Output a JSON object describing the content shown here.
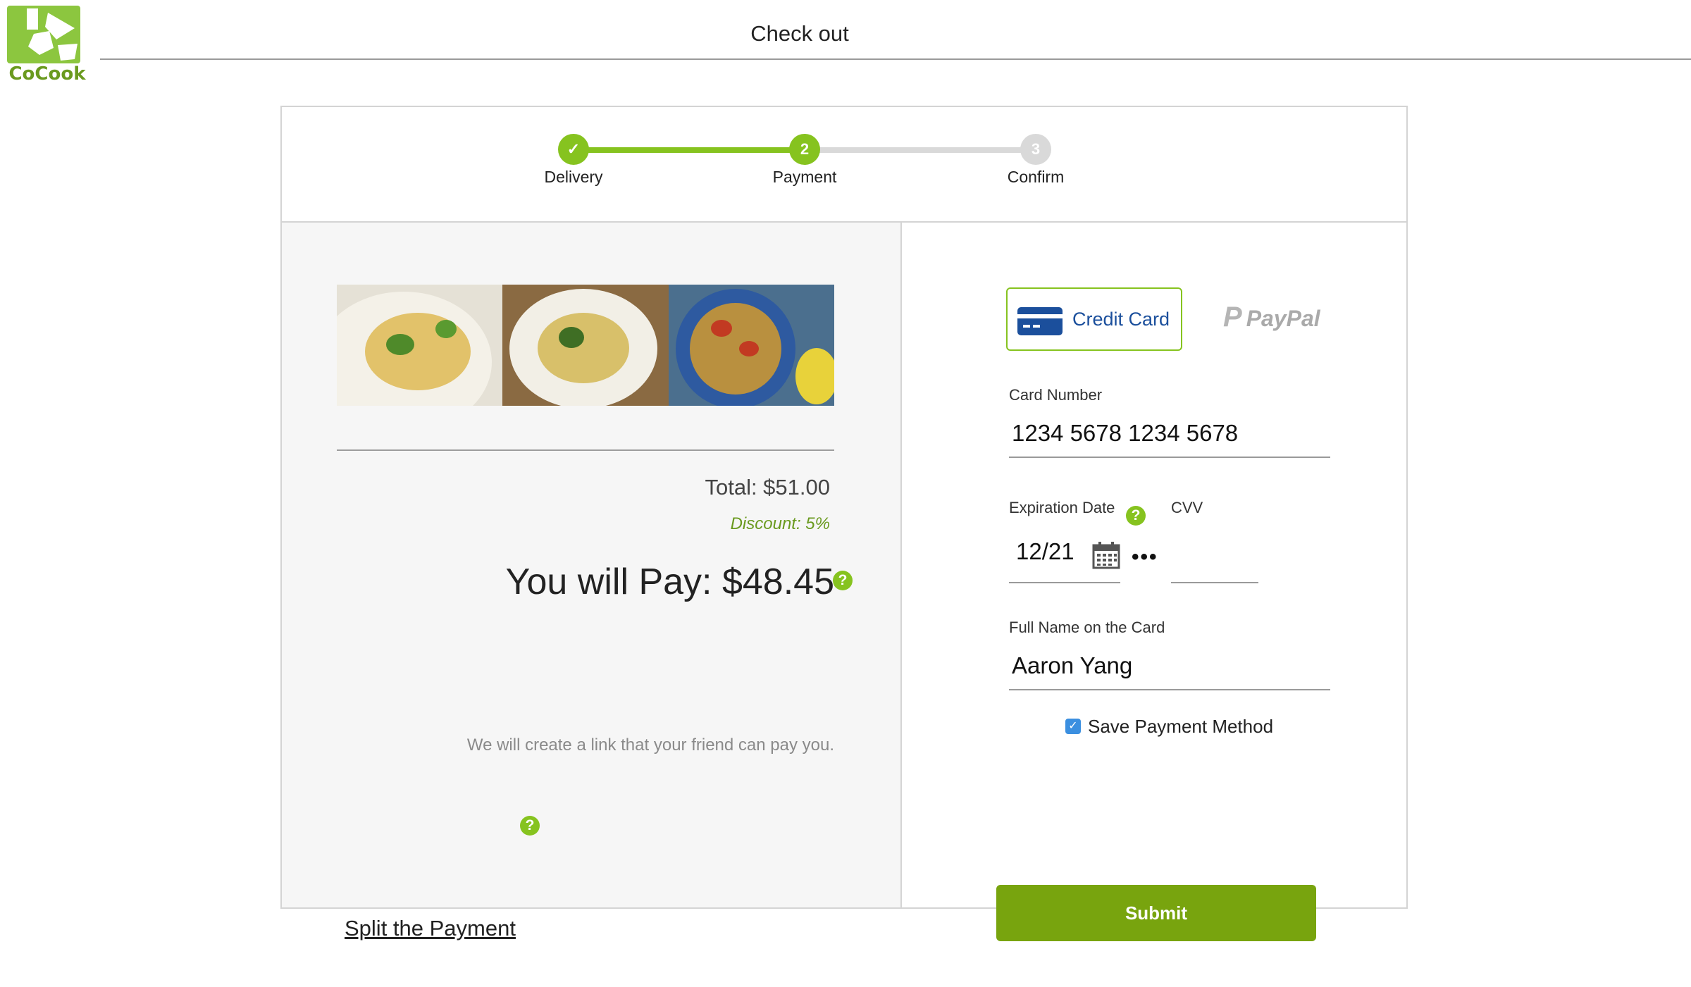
{
  "brand": {
    "name": "CoCook",
    "color": "#86c31f"
  },
  "header": {
    "title": "Check out"
  },
  "stepper": {
    "steps": [
      {
        "label": "Delivery",
        "marker": "✓",
        "status": "complete"
      },
      {
        "label": "Payment",
        "marker": "2",
        "status": "current"
      },
      {
        "label": "Confirm",
        "marker": "3",
        "status": "upcoming"
      }
    ]
  },
  "summary": {
    "total": "Total: $51.00",
    "discount": "Discount: 5%",
    "pay": "You will Pay: $48.45",
    "pay_help": "?",
    "note": "We will create a link that your friend can pay you.",
    "split_link": "Split the Payment",
    "split_help": "?"
  },
  "payment_methods": {
    "credit_card": "Credit Card",
    "paypal": "PayPal",
    "paypal_mark": "P",
    "selected": "Credit Card"
  },
  "form": {
    "card_number_label": "Card Number",
    "card_number": "1234 5678 1234 5678",
    "expiration_label": "Expiration Date",
    "expiration": "12/21",
    "cvv_label": "CVV",
    "cvv_help": "?",
    "cvv_masked": "•••",
    "name_label": "Full Name on the Card",
    "name": "Aaron Yang",
    "save_checked": true,
    "save_mark": "✓",
    "save_label": "Save Payment Method",
    "submit_label": "Submit"
  }
}
